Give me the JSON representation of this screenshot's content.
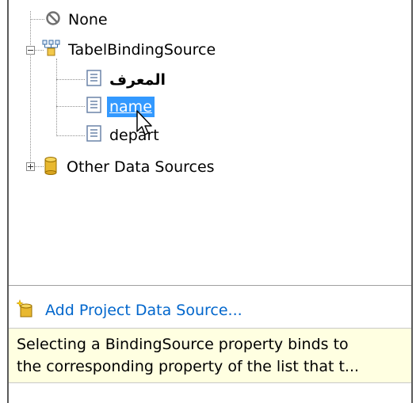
{
  "tree": {
    "none_label": "None",
    "binding_source_label": "TabelBindingSource",
    "fields": [
      {
        "label": "المعرف"
      },
      {
        "label": "name"
      },
      {
        "label": "depart"
      }
    ],
    "other_sources_label": "Other Data Sources"
  },
  "footer": {
    "add_source_label": "Add Project Data Source...",
    "description_line1": "Selecting a BindingSource property binds to",
    "description_line2": "the corresponding property of the list that t..."
  },
  "colors": {
    "selection": "#3399ff",
    "link": "#0066cc",
    "tooltip_bg": "#ffffe1"
  }
}
